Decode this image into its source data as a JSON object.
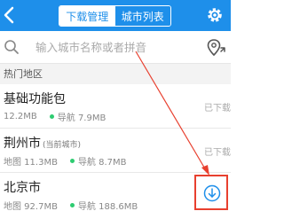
{
  "header": {
    "tabs": [
      {
        "label": "下载管理",
        "active": false
      },
      {
        "label": "城市列表",
        "active": true
      }
    ],
    "icons": {
      "back": "back-icon",
      "settings": "settings-gear-icon"
    }
  },
  "search": {
    "placeholder": "输入城市名称或者拼音",
    "value": "",
    "icons": {
      "search": "search-icon",
      "locate": "locate-icon"
    }
  },
  "section": {
    "title": "热门地区"
  },
  "rows": [
    {
      "title": "基础功能包",
      "title_suffix": "",
      "map_size": "12.2MB",
      "nav_size": "导航 7.9MB",
      "status": "已下载"
    },
    {
      "title": "荆州市",
      "title_suffix": "(当前城市)",
      "map_size": "地图 11.3MB",
      "nav_size": "导航 8.7MB",
      "status": "已下载"
    },
    {
      "title": "北京市",
      "title_suffix": "",
      "map_size": "地图 92.7MB",
      "nav_size": "导航 188.6MB",
      "status": ""
    }
  ],
  "annotation": {
    "color": "#e8402f",
    "target": "download-button"
  },
  "colors": {
    "accent": "#1e8fea",
    "nav_dot": "#2ecc71",
    "highlight": "#e8402f"
  }
}
